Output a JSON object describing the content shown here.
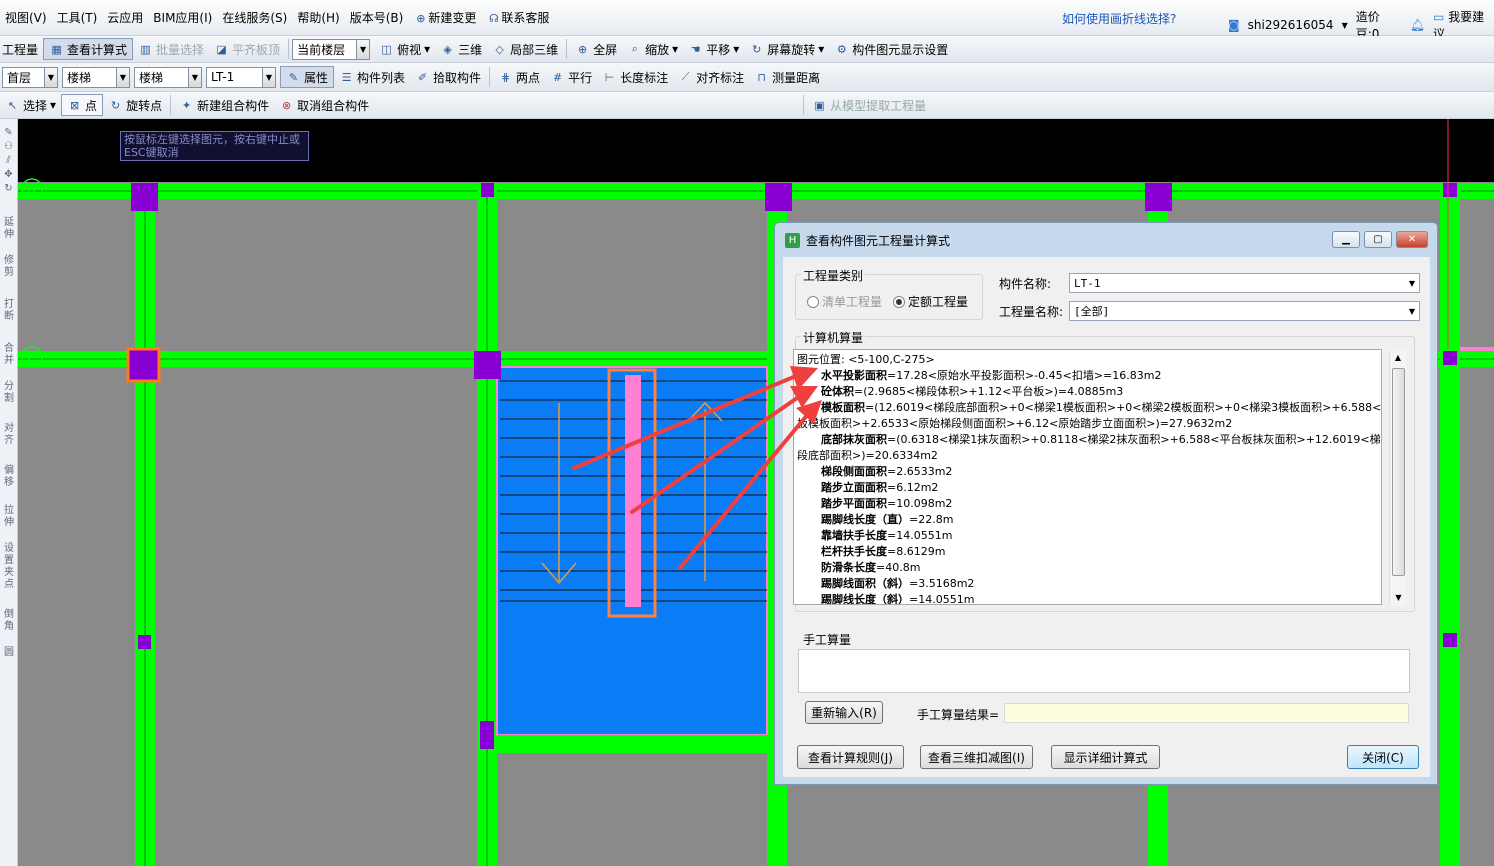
{
  "menu": {
    "items": [
      "视图(V)",
      "工具(T)",
      "云应用",
      "BIM应用(I)",
      "在线服务(S)",
      "帮助(H)",
      "版本号(B)",
      "新建变更",
      "联系客服"
    ],
    "help_link": "如何使用画折线选择?",
    "username": "shi292616054",
    "price_beans": "造价豆:0",
    "suggest": "我要建议"
  },
  "toolbar1": {
    "items": [
      "工程量",
      "查看计算式",
      "批量选择",
      "平齐板顶"
    ],
    "floor_combo": "当前楼层",
    "items2": [
      "俯视",
      "三维",
      "局部三维",
      "全屏",
      "缩放",
      "平移",
      "屏幕旋转",
      "构件图元显示设置"
    ]
  },
  "toolbar2": {
    "combos": [
      "首层",
      "楼梯",
      "楼梯",
      "LT-1"
    ],
    "items": [
      "属性",
      "构件列表",
      "拾取构件",
      "两点",
      "平行",
      "长度标注",
      "对齐标注",
      "测量距离"
    ]
  },
  "toolbar3": {
    "items": [
      "选择",
      "点",
      "旋转点",
      "新建组合构件",
      "取消组合构件",
      "从模型提取工程量"
    ]
  },
  "left_tools": [
    "延伸",
    "修剪",
    "打断",
    "合并",
    "分割",
    "对齐",
    "偏移",
    "拉伸",
    "设置夹点",
    "倒角",
    "圆"
  ],
  "canvas": {
    "hint": "按鼠标左键选择图元，按右键中止或ESC键取消",
    "axis_labels": [
      "D",
      "C"
    ]
  },
  "dialog": {
    "title": "查看构件图元工程量计算式",
    "qty_type_label": "工程量类别",
    "radio_list": "清单工程量",
    "radio_quota": "定额工程量",
    "comp_name_label": "构件名称:",
    "comp_name_value": "LT-1",
    "qty_name_label": "工程量名称:",
    "qty_name_value": "[全部]",
    "calc_label": "计算机算量",
    "calc_lines": [
      {
        "k": "",
        "v": "图元位置: <5-100,C-275>"
      },
      {
        "k": "水平投影面积",
        "v": "=17.28<原始水平投影面积>-0.45<扣墙>=16.83m2"
      },
      {
        "k": "砼体积",
        "v": "=(2.9685<梯段体积>+1.12<平台板>)=4.0885m3"
      },
      {
        "k": "模板面积",
        "v": "=(12.6019<梯段底部面积>+0<梯梁1模板面积>+0<梯梁2模板面积>+0<梯梁3模板面积>+6.588<平"
      },
      {
        "k": "",
        "v": "板模板面积>+2.6533<原始梯段侧面面积>+6.12<原始踏步立面面积>)=27.9632m2"
      },
      {
        "k": "底部抹灰面积",
        "v": "=(0.6318<梯梁1抹灰面积>+0.8118<梯梁2抹灰面积>+6.588<平台板抹灰面积>+12.6019<梯"
      },
      {
        "k": "",
        "v": "段底部面积>)=20.6334m2"
      },
      {
        "k": "梯段侧面面积",
        "v": "=2.6533m2"
      },
      {
        "k": "踏步立面面积",
        "v": "=6.12m2"
      },
      {
        "k": "踏步平面面积",
        "v": "=10.098m2"
      },
      {
        "k": "踢脚线长度（直）",
        "v": "=22.8m"
      },
      {
        "k": "靠墙扶手长度",
        "v": "=14.0551m"
      },
      {
        "k": "栏杆扶手长度",
        "v": "=8.6129m"
      },
      {
        "k": "防滑条长度",
        "v": "=40.8m"
      },
      {
        "k": "踢脚线面积（斜）",
        "v": "=3.5168m2"
      },
      {
        "k": "踢脚线长度（斜）",
        "v": "=14.0551m"
      }
    ],
    "manual_label": "手工算量",
    "reenter_btn": "重新输入(R)",
    "manual_result_label": "手工算量结果=",
    "view_rule_btn": "查看计算规则(J)",
    "view_3d_btn": "查看三维扣减图(I)",
    "show_detail_btn": "显示详细计算式",
    "close_btn": "关闭(C)"
  }
}
